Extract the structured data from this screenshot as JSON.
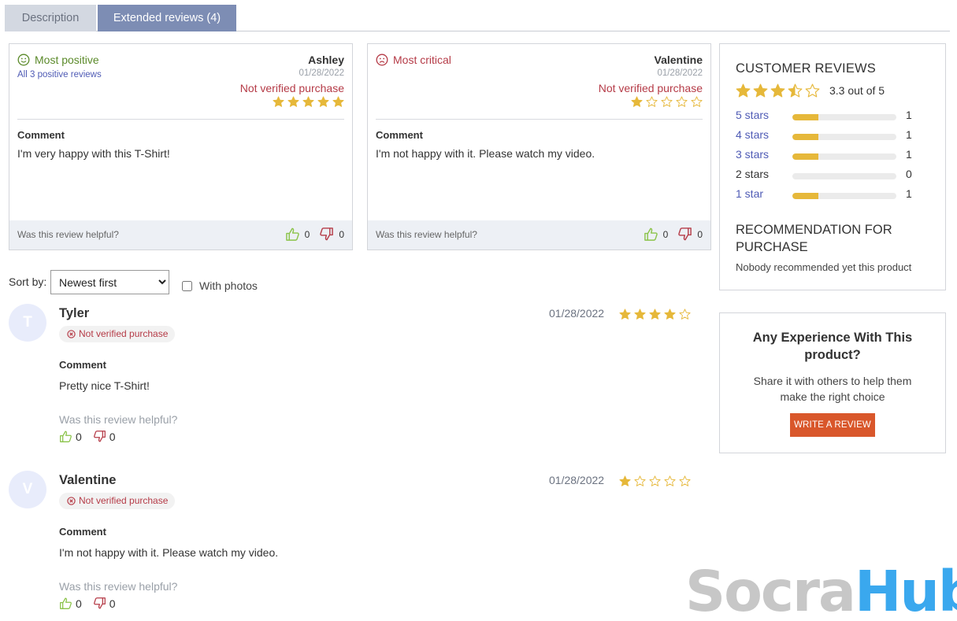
{
  "tabs": [
    {
      "label": "Description",
      "active": false
    },
    {
      "label": "Extended reviews (4)",
      "active": true
    }
  ],
  "highlights": {
    "positive": {
      "heading": "Most positive",
      "link": "All 3 positive reviews",
      "author": "Ashley",
      "date": "01/28/2022",
      "verification": "Not verified purchase",
      "rating": 5,
      "comment_label": "Comment",
      "comment": "I'm very happy with this T-Shirt!",
      "helpful_question": "Was this review helpful?",
      "likes": "0",
      "dislikes": "0"
    },
    "critical": {
      "heading": "Most critical",
      "author": "Valentine",
      "date": "01/28/2022",
      "verification": "Not verified purchase",
      "rating": 1,
      "comment_label": "Comment",
      "comment": "I'm not happy with it. Please watch my video.",
      "helpful_question": "Was this review helpful?",
      "likes": "0",
      "dislikes": "0"
    }
  },
  "sort": {
    "label": "Sort by:",
    "selected": "Newest first",
    "photos_label": "With photos",
    "photos_checked": false
  },
  "reviews": [
    {
      "initial": "T",
      "name": "Tyler",
      "badge": "Not verified purchase",
      "date": "01/28/2022",
      "rating": 4,
      "comment_label": "Comment",
      "comment": "Pretty nice T-Shirt!",
      "helpful_question": "Was this review helpful?",
      "likes": "0",
      "dislikes": "0"
    },
    {
      "initial": "V",
      "name": "Valentine",
      "badge": "Not verified purchase",
      "date": "01/28/2022",
      "rating": 1,
      "comment_label": "Comment",
      "comment": "I'm not happy with it. Please watch my video.",
      "helpful_question": "Was this review helpful?",
      "likes": "0",
      "dislikes": "0"
    }
  ],
  "summary": {
    "title": "CUSTOMER REVIEWS",
    "average_rating": 3.3,
    "score_text": "3.3 out of 5",
    "rows": [
      {
        "label": "5 stars",
        "count": "1",
        "fraction": 0.25,
        "linked": true
      },
      {
        "label": "4 stars",
        "count": "1",
        "fraction": 0.25,
        "linked": true
      },
      {
        "label": "3 stars",
        "count": "1",
        "fraction": 0.25,
        "linked": true
      },
      {
        "label": "2 stars",
        "count": "0",
        "fraction": 0,
        "linked": false
      },
      {
        "label": "1 star",
        "count": "1",
        "fraction": 0.25,
        "linked": true
      }
    ],
    "recommendation_title": "RECOMMENDATION FOR PURCHASE",
    "recommendation_text": "Nobody recommended yet this product"
  },
  "cta": {
    "title": "Any Experience With This product?",
    "text": "Share it with others to help them make the right choice",
    "button": "WRITE A REVIEW"
  },
  "watermark": {
    "part1": "Socra",
    "part2": "Hub"
  },
  "colors": {
    "star": "#e6b83a",
    "positive": "#5b8a2a",
    "critical": "#b53b47",
    "tab_active": "#7d8db4",
    "button": "#d9572b",
    "like": "#8bc34a",
    "dislike": "#b53b47"
  }
}
